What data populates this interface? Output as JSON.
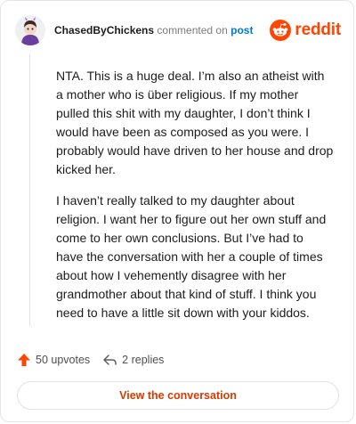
{
  "header": {
    "username": "ChasedByChickens",
    "action_text": "commented on",
    "post_link": "post",
    "brand_name": "reddit"
  },
  "comment": {
    "paragraphs": [
      "NTA. This is a huge deal. I’m also an atheist with a mother who is über religious. If my mother pulled this shit with my daughter, I don’t think I would have been as composed as you were. I probably would have driven to her house and drop kicked her.",
      "I haven’t really talked to my daughter about religion. I want her to figure out her own stuff and come to her own conclusions. But I’ve had to have the conversation with her a couple of times about how I vehemently disagree with her grandmother about that kind of stuff. I think you need to have a little sit down with your kiddos."
    ]
  },
  "stats": {
    "upvotes": "50 upvotes",
    "replies": "2 replies"
  },
  "cta": {
    "label": "View the conversation"
  },
  "colors": {
    "brand": "#ff4500",
    "link": "#0079d3",
    "cta": "#d93a00"
  },
  "icons": [
    "avatar",
    "reddit-logo-icon",
    "upvote-icon",
    "reply-icon"
  ]
}
